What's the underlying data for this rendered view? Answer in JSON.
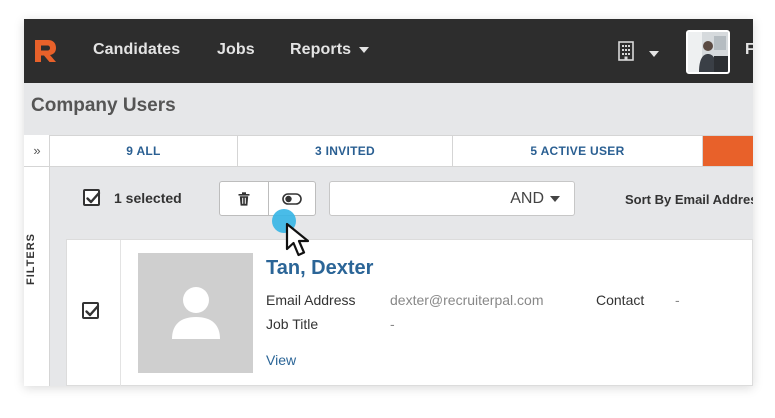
{
  "nav": {
    "brand_color": "#e8612a",
    "items": [
      {
        "label": "Candidates"
      },
      {
        "label": "Jobs"
      },
      {
        "label": "Reports"
      }
    ],
    "company_icon": "building-icon",
    "avatar_edge_text": "F"
  },
  "page": {
    "title": "Company Users"
  },
  "filters": {
    "label": "FILTERS",
    "toggle_icon": "double-chevron-right-icon"
  },
  "tabs": [
    {
      "label": "9 ALL"
    },
    {
      "label": "3 INVITED"
    },
    {
      "label": "5 ACTIVE USER"
    },
    {
      "label": "",
      "color": "#e8612a"
    }
  ],
  "toolbar": {
    "selected_text": "1 selected",
    "delete_icon": "trash-icon",
    "toggle_icon": "toggle-icon",
    "search_operator": "AND",
    "sort_label": "Sort By Email Address"
  },
  "user_card": {
    "name": "Tan, Dexter",
    "email_label": "Email Address",
    "email_value": "dexter@recruiterpal.com",
    "contact_label": "Contact",
    "contact_value": "-",
    "job_title_label": "Job Title",
    "job_title_value": "-",
    "view_label": "View",
    "checked": true
  },
  "colors": {
    "accent": "#e8612a",
    "link": "#2b6597",
    "topbar": "#2d2d2d"
  }
}
